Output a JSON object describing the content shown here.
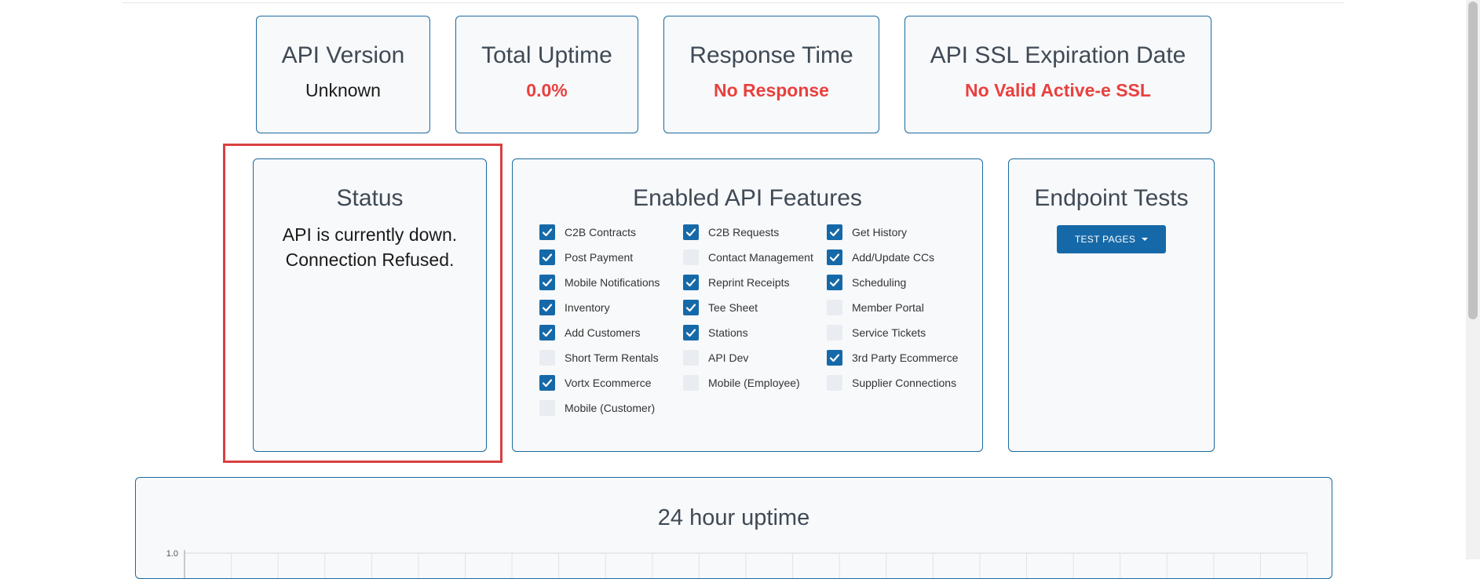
{
  "stats": {
    "api_version": {
      "title": "API Version",
      "value": "Unknown"
    },
    "total_uptime": {
      "title": "Total Uptime",
      "value": "0.0%"
    },
    "response_time": {
      "title": "Response Time",
      "value": "No Response"
    },
    "ssl_expiration": {
      "title": "API SSL Expiration Date",
      "value": "No Valid Active-e SSL"
    }
  },
  "status": {
    "title": "Status",
    "line1": "API is currently down.",
    "line2": "Connection Refused."
  },
  "features": {
    "title": "Enabled API Features",
    "items": [
      {
        "label": "C2B Contracts",
        "checked": true
      },
      {
        "label": "C2B Requests",
        "checked": true
      },
      {
        "label": "Get History",
        "checked": true
      },
      {
        "label": "Post Payment",
        "checked": true
      },
      {
        "label": "Contact Management",
        "checked": false
      },
      {
        "label": "Add/Update CCs",
        "checked": true
      },
      {
        "label": "Mobile Notifications",
        "checked": true
      },
      {
        "label": "Reprint Receipts",
        "checked": true
      },
      {
        "label": "Scheduling",
        "checked": true
      },
      {
        "label": "Inventory",
        "checked": true
      },
      {
        "label": "Tee Sheet",
        "checked": true
      },
      {
        "label": "Member Portal",
        "checked": false
      },
      {
        "label": "Add Customers",
        "checked": true
      },
      {
        "label": "Stations",
        "checked": true
      },
      {
        "label": "Service Tickets",
        "checked": false
      },
      {
        "label": "Short Term Rentals",
        "checked": false
      },
      {
        "label": "API Dev",
        "checked": false
      },
      {
        "label": "3rd Party Ecommerce",
        "checked": true
      },
      {
        "label": "Vortx Ecommerce",
        "checked": true
      },
      {
        "label": "Mobile (Employee)",
        "checked": false
      },
      {
        "label": "Supplier Connections",
        "checked": false
      },
      {
        "label": "Mobile (Customer)",
        "checked": false
      }
    ]
  },
  "endpoint": {
    "title": "Endpoint Tests",
    "button_label": "TEST PAGES"
  },
  "chart_data": {
    "type": "line",
    "title": "24 hour uptime",
    "y_tick_top": "1.0",
    "ylim": [
      0,
      1.0
    ],
    "grid": true
  },
  "colors": {
    "accent": "#1669a8",
    "error": "#e8413e",
    "card_border": "#1a6aa0"
  }
}
